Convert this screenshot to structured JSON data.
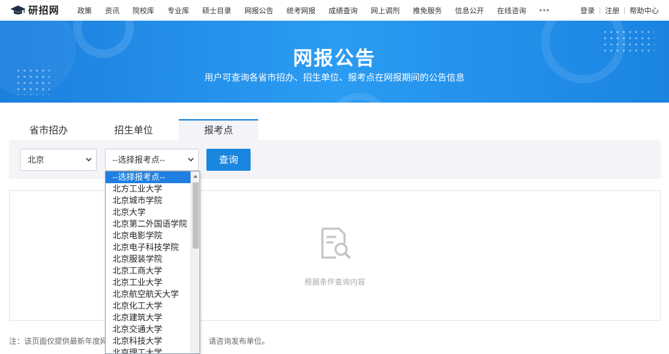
{
  "site": {
    "logo_text": "研招网"
  },
  "nav": {
    "items": [
      "政策",
      "资讯",
      "院校库",
      "专业库",
      "硕士目录",
      "网报公告",
      "统考网报",
      "成绩查询",
      "网上调剂",
      "推免服务",
      "信息公开",
      "在线咨询"
    ],
    "more": "•••",
    "right": {
      "login": "登录",
      "sep": "|",
      "register": "注册",
      "help": "帮助中心"
    }
  },
  "banner": {
    "title": "网报公告",
    "subtitle": "用户可查询各省市招办、招生单位、报考点在网报期间的公告信息"
  },
  "tabs": [
    {
      "label": "省市招办",
      "active": false
    },
    {
      "label": "招生单位",
      "active": false
    },
    {
      "label": "报考点",
      "active": true
    }
  ],
  "search": {
    "province_value": "北京",
    "site_value": "--选择报考点--",
    "query_label": "查询"
  },
  "result": {
    "empty_text": "根据条件查询内容"
  },
  "note": "注：该页面仅提供最新年度网",
  "note_tail": "请咨询发布单位。",
  "dropdown": {
    "options": [
      "--选择报考点--",
      "北方工业大学",
      "北京城市学院",
      "北京大学",
      "北京第二外国语学院",
      "北京电影学院",
      "北京电子科技学院",
      "北京服装学院",
      "北京工商大学",
      "北京工业大学",
      "北京航空航天大学",
      "北京化工大学",
      "北京建筑大学",
      "北京交通大学",
      "北京科技大学",
      "北京理工大学"
    ],
    "selected_index": 0
  },
  "colors": {
    "accent": "#1a86de",
    "banner": "#2b9cf2"
  }
}
